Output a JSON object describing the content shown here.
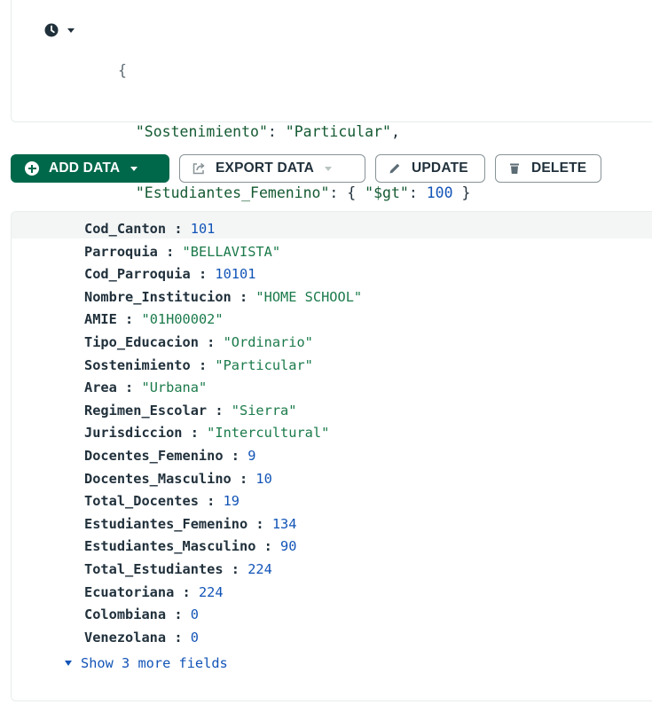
{
  "query": {
    "open_brace": "{",
    "close_brace": "}",
    "line1": {
      "key": "\"Sostenimiento\"",
      "colon": ": ",
      "value": "\"Particular\"",
      "comma": ","
    },
    "line2": {
      "key": "\"Estudiantes_Femenino\"",
      "colon": ": ",
      "obj_open": "{ ",
      "op": "\"$gt\"",
      "op_colon": ": ",
      "op_value": "100",
      "obj_close": " }"
    }
  },
  "toolbar": {
    "add_data_label": "ADD DATA",
    "export_data_label": "EXPORT DATA",
    "update_label": "UPDATE",
    "delete_label": "DELETE"
  },
  "document": {
    "fields": [
      {
        "key": "Cod_Canton",
        "value": "101",
        "type": "number"
      },
      {
        "key": "Parroquia",
        "value": "\"BELLAVISTA\"",
        "type": "string"
      },
      {
        "key": "Cod_Parroquia",
        "value": "10101",
        "type": "number"
      },
      {
        "key": "Nombre_Institucion",
        "value": "\"HOME SCHOOL\"",
        "type": "string"
      },
      {
        "key": "AMIE",
        "value": "\"01H00002\"",
        "type": "string"
      },
      {
        "key": "Tipo_Educacion",
        "value": "\"Ordinario\"",
        "type": "string"
      },
      {
        "key": "Sostenimiento",
        "value": "\"Particular\"",
        "type": "string"
      },
      {
        "key": "Area",
        "value": "\"Urbana\"",
        "type": "string"
      },
      {
        "key": "Regimen_Escolar",
        "value": "\"Sierra\"",
        "type": "string"
      },
      {
        "key": "Jurisdiccion",
        "value": "\"Intercultural\"",
        "type": "string"
      },
      {
        "key": "Docentes_Femenino",
        "value": "9",
        "type": "number"
      },
      {
        "key": "Docentes_Masculino",
        "value": "10",
        "type": "number"
      },
      {
        "key": "Total_Docentes",
        "value": "19",
        "type": "number"
      },
      {
        "key": "Estudiantes_Femenino",
        "value": "134",
        "type": "number"
      },
      {
        "key": "Estudiantes_Masculino",
        "value": "90",
        "type": "number"
      },
      {
        "key": "Total_Estudiantes",
        "value": "224",
        "type": "number"
      },
      {
        "key": "Ecuatoriana",
        "value": "224",
        "type": "number"
      },
      {
        "key": "Colombiana",
        "value": "0",
        "type": "number"
      },
      {
        "key": "Venezolana",
        "value": "0",
        "type": "number"
      }
    ],
    "separator": " : ",
    "show_more_label": "Show 3 more fields"
  }
}
